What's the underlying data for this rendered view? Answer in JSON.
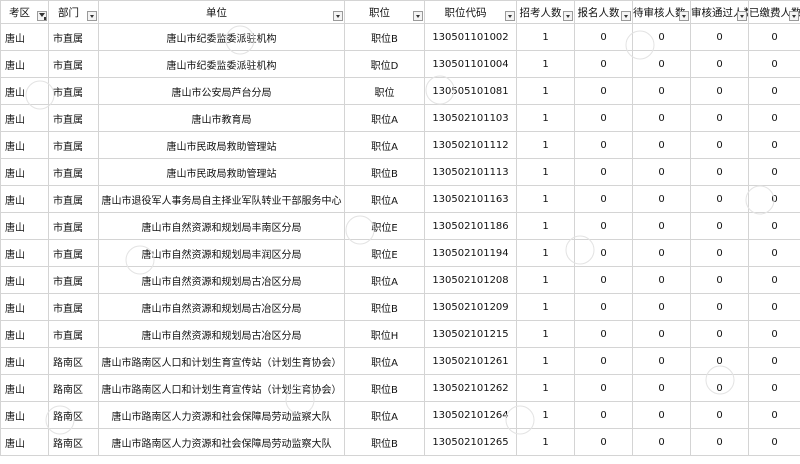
{
  "columns": [
    {
      "key": "area",
      "label": "考区",
      "filter_active": true
    },
    {
      "key": "dept",
      "label": "部门",
      "filter_active": false
    },
    {
      "key": "unit",
      "label": "单位",
      "filter_active": false
    },
    {
      "key": "position",
      "label": "职位",
      "filter_active": false
    },
    {
      "key": "code",
      "label": "职位代码",
      "filter_active": false
    },
    {
      "key": "quota",
      "label": "招考人数",
      "filter_active": false
    },
    {
      "key": "applied",
      "label": "报名人数",
      "filter_active": false
    },
    {
      "key": "pending",
      "label": "待审核人数",
      "filter_active": false
    },
    {
      "key": "passed",
      "label": "审核通过人数",
      "filter_active": false
    },
    {
      "key": "paid",
      "label": "已缴费人数",
      "filter_active": false
    }
  ],
  "rows": [
    [
      "唐山",
      "市直属",
      "唐山市纪委监委派驻机构",
      "职位B",
      "130501101002",
      "1",
      "0",
      "0",
      "0",
      "0"
    ],
    [
      "唐山",
      "市直属",
      "唐山市纪委监委派驻机构",
      "职位D",
      "130501101004",
      "1",
      "0",
      "0",
      "0",
      "0"
    ],
    [
      "唐山",
      "市直属",
      "唐山市公安局芦台分局",
      "职位",
      "130505101081",
      "1",
      "0",
      "0",
      "0",
      "0"
    ],
    [
      "唐山",
      "市直属",
      "唐山市教育局",
      "职位A",
      "130502101103",
      "1",
      "0",
      "0",
      "0",
      "0"
    ],
    [
      "唐山",
      "市直属",
      "唐山市民政局救助管理站",
      "职位A",
      "130502101112",
      "1",
      "0",
      "0",
      "0",
      "0"
    ],
    [
      "唐山",
      "市直属",
      "唐山市民政局救助管理站",
      "职位B",
      "130502101113",
      "1",
      "0",
      "0",
      "0",
      "0"
    ],
    [
      "唐山",
      "市直属",
      "唐山市退役军人事务局自主择业军队转业干部服务中心",
      "职位A",
      "130502101163",
      "1",
      "0",
      "0",
      "0",
      "0"
    ],
    [
      "唐山",
      "市直属",
      "唐山市自然资源和规划局丰南区分局",
      "职位E",
      "130502101186",
      "1",
      "0",
      "0",
      "0",
      "0"
    ],
    [
      "唐山",
      "市直属",
      "唐山市自然资源和规划局丰润区分局",
      "职位E",
      "130502101194",
      "1",
      "0",
      "0",
      "0",
      "0"
    ],
    [
      "唐山",
      "市直属",
      "唐山市自然资源和规划局古冶区分局",
      "职位A",
      "130502101208",
      "1",
      "0",
      "0",
      "0",
      "0"
    ],
    [
      "唐山",
      "市直属",
      "唐山市自然资源和规划局古冶区分局",
      "职位B",
      "130502101209",
      "1",
      "0",
      "0",
      "0",
      "0"
    ],
    [
      "唐山",
      "市直属",
      "唐山市自然资源和规划局古冶区分局",
      "职位H",
      "130502101215",
      "1",
      "0",
      "0",
      "0",
      "0"
    ],
    [
      "唐山",
      "路南区",
      "唐山市路南区人口和计划生育宣传站（计划生育协会）",
      "职位A",
      "130502101261",
      "1",
      "0",
      "0",
      "0",
      "0"
    ],
    [
      "唐山",
      "路南区",
      "唐山市路南区人口和计划生育宣传站（计划生育协会）",
      "职位B",
      "130502101262",
      "1",
      "0",
      "0",
      "0",
      "0"
    ],
    [
      "唐山",
      "路南区",
      "唐山市路南区人力资源和社会保障局劳动监察大队",
      "职位A",
      "130502101264",
      "1",
      "0",
      "0",
      "0",
      "0"
    ],
    [
      "唐山",
      "路南区",
      "唐山市路南区人力资源和社会保障局劳动监察大队",
      "职位B",
      "130502101265",
      "1",
      "0",
      "0",
      "0",
      "0"
    ]
  ]
}
